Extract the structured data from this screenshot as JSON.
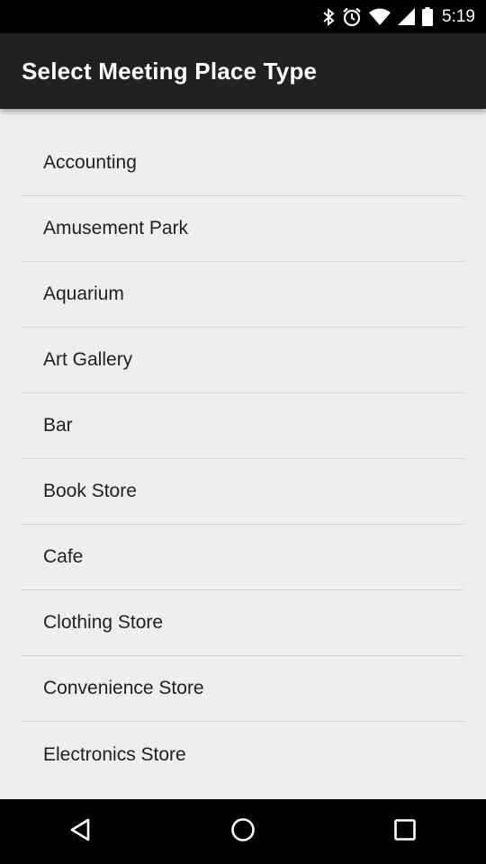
{
  "status_bar": {
    "time": "5:19",
    "icons": [
      "bluetooth-icon",
      "alarm-icon",
      "wifi-icon",
      "signal-icon",
      "battery-icon"
    ]
  },
  "app_bar": {
    "title": "Select Meeting Place Type",
    "background": "#212121"
  },
  "list": {
    "items": [
      "Accounting",
      "Amusement Park",
      "Aquarium",
      "Art Gallery",
      "Bar",
      "Book Store",
      "Cafe",
      "Clothing Store",
      "Convenience Store",
      "Electronics Store"
    ]
  },
  "nav_bar": {
    "buttons": [
      "back-icon",
      "home-icon",
      "recents-icon"
    ]
  }
}
